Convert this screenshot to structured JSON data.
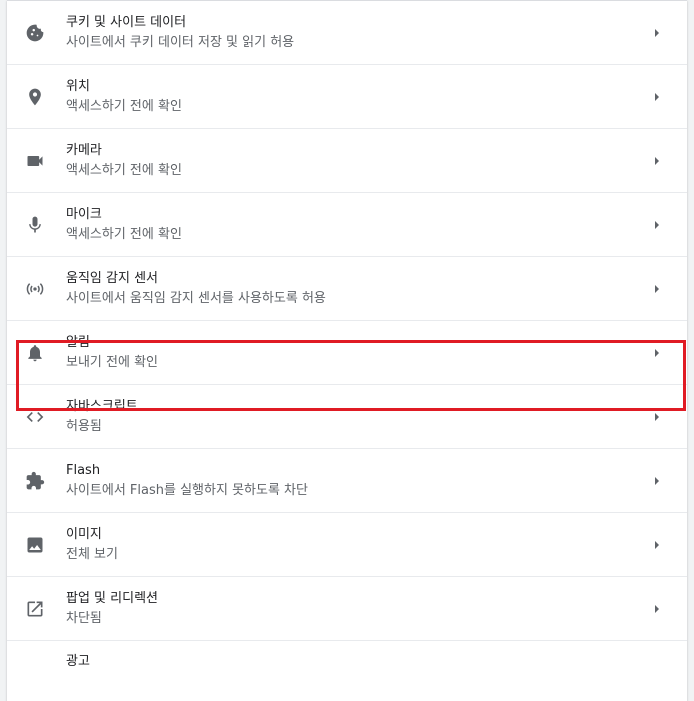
{
  "settings": [
    {
      "title": "쿠키 및 사이트 데이터",
      "subtitle": "사이트에서 쿠키 데이터 저장 및 읽기 허용",
      "icon": "cookie-icon"
    },
    {
      "title": "위치",
      "subtitle": "액세스하기 전에 확인",
      "icon": "location-pin-icon"
    },
    {
      "title": "카메라",
      "subtitle": "액세스하기 전에 확인",
      "icon": "camera-icon"
    },
    {
      "title": "마이크",
      "subtitle": "액세스하기 전에 확인",
      "icon": "microphone-icon"
    },
    {
      "title": "움직임 감지 센서",
      "subtitle": "사이트에서 움직임 감지 센서를 사용하도록 허용",
      "icon": "sensors-icon"
    },
    {
      "title": "알림",
      "subtitle": "보내기 전에 확인",
      "icon": "bell-icon"
    },
    {
      "title": "자바스크립트",
      "subtitle": "허용됨",
      "icon": "code-icon"
    },
    {
      "title": "Flash",
      "subtitle": "사이트에서 Flash를 실행하지 못하도록 차단",
      "icon": "puzzle-icon"
    },
    {
      "title": "이미지",
      "subtitle": "전체 보기",
      "icon": "image-icon"
    },
    {
      "title": "팝업 및 리디렉션",
      "subtitle": "차단됨",
      "icon": "open-in-new-icon"
    },
    {
      "title": "광고",
      "subtitle": "",
      "icon": ""
    }
  ],
  "colors": {
    "highlight": "#e01b24",
    "icon": "#5f6368"
  }
}
